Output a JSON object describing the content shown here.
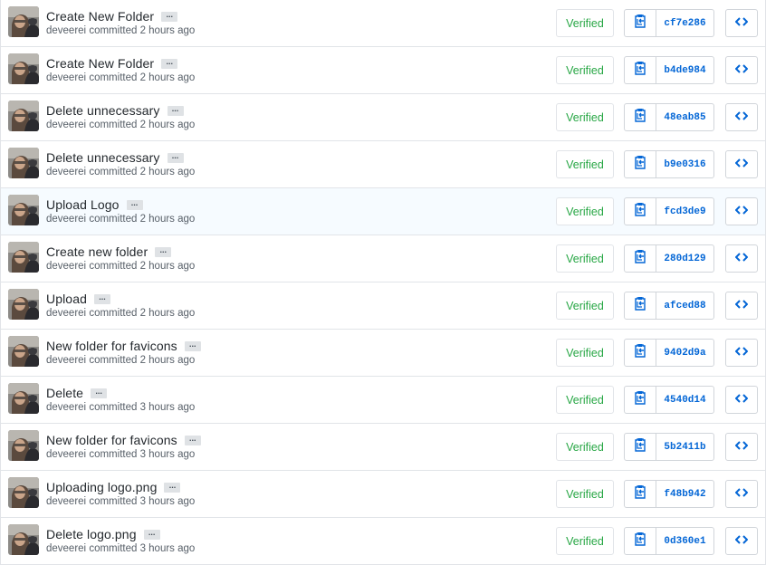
{
  "commits": [
    {
      "message": "Create New Folder",
      "author": "deveerei",
      "time": "committed 2 hours ago",
      "verified": "Verified",
      "sha": "cf7e286",
      "ellipsis": "..."
    },
    {
      "message": "Create New Folder",
      "author": "deveerei",
      "time": "committed 2 hours ago",
      "verified": "Verified",
      "sha": "b4de984",
      "ellipsis": "..."
    },
    {
      "message": "Delete unnecessary",
      "author": "deveerei",
      "time": "committed 2 hours ago",
      "verified": "Verified",
      "sha": "48eab85",
      "ellipsis": "..."
    },
    {
      "message": "Delete unnecessary",
      "author": "deveerei",
      "time": "committed 2 hours ago",
      "verified": "Verified",
      "sha": "b9e0316",
      "ellipsis": "..."
    },
    {
      "message": "Upload Logo",
      "author": "deveerei",
      "time": "committed 2 hours ago",
      "verified": "Verified",
      "sha": "fcd3de9",
      "ellipsis": "..."
    },
    {
      "message": "Create new folder",
      "author": "deveerei",
      "time": "committed 2 hours ago",
      "verified": "Verified",
      "sha": "280d129",
      "ellipsis": "..."
    },
    {
      "message": "Upload",
      "author": "deveerei",
      "time": "committed 2 hours ago",
      "verified": "Verified",
      "sha": "afced88",
      "ellipsis": "..."
    },
    {
      "message": "New folder for favicons",
      "author": "deveerei",
      "time": "committed 2 hours ago",
      "verified": "Verified",
      "sha": "9402d9a",
      "ellipsis": "..."
    },
    {
      "message": "Delete",
      "author": "deveerei",
      "time": "committed 3 hours ago",
      "verified": "Verified",
      "sha": "4540d14",
      "ellipsis": "..."
    },
    {
      "message": "New folder for favicons",
      "author": "deveerei",
      "time": "committed 3 hours ago",
      "verified": "Verified",
      "sha": "5b2411b",
      "ellipsis": "..."
    },
    {
      "message": "Uploading logo.png",
      "author": "deveerei",
      "time": "committed 3 hours ago",
      "verified": "Verified",
      "sha": "f48b942",
      "ellipsis": "..."
    },
    {
      "message": "Delete logo.png",
      "author": "deveerei",
      "time": "committed 3 hours ago",
      "verified": "Verified",
      "sha": "0d360e1",
      "ellipsis": "..."
    }
  ],
  "highlighted_row": 4,
  "icons": {
    "copy": "clipboard-icon",
    "browse": "code-icon"
  },
  "colors": {
    "verified": "#28a745",
    "sha_link": "#0366d6",
    "icon_blue": "#0366d6",
    "border": "#e1e4e8",
    "highlight_bg": "#f6fbff"
  }
}
